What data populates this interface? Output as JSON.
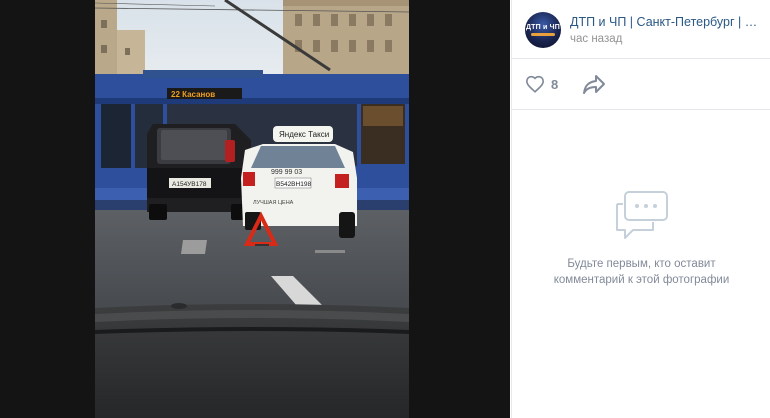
{
  "post": {
    "group_name": "ДТП и ЧП | Санкт-Петербург | Питер онлайн",
    "time": "час назад",
    "avatar_text": "ДТП и ЧП"
  },
  "actions": {
    "like_icon": "heart-icon",
    "likes": "8",
    "share_icon": "share-arrow-icon"
  },
  "photo": {
    "tram_route": "22 Касанов",
    "taxi_sign": "Яндекс Такси",
    "taxi_phone": "999 99 03",
    "taxi_plate": "В542ВН198",
    "car_plate": "А154УВ178",
    "taxi_text": "ЛУЧШАЯ ЦЕНА"
  },
  "comments": {
    "empty_icon": "speech-bubbles-icon",
    "empty_text": "Будьте первым, кто оставит комментарий к этой фотографии"
  },
  "colors": {
    "link": "#2a5885",
    "muted": "#828a99",
    "tram": "#2d4f9c"
  }
}
